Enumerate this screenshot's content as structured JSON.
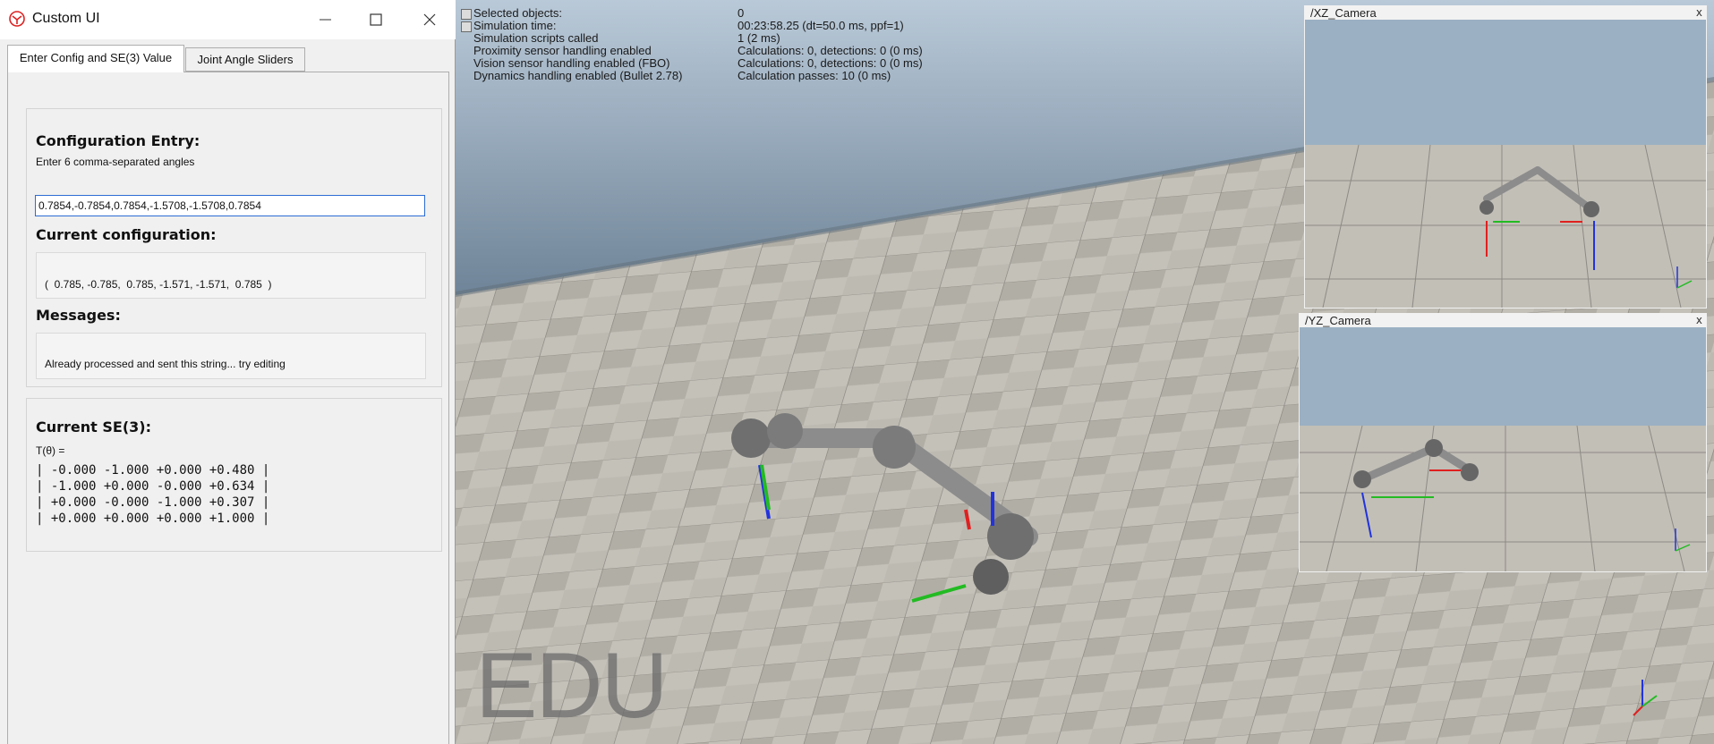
{
  "window": {
    "title": "Custom UI"
  },
  "tabs": [
    {
      "label": "Enter Config and SE(3) Value"
    },
    {
      "label": "Joint Angle Sliders"
    }
  ],
  "config": {
    "heading": "Configuration Entry:",
    "hint": "Enter 6 comma-separated angles",
    "input_value": "0.7854,-0.7854,0.7854,-1.5708,-1.5708,0.7854",
    "current_heading": "Current configuration:",
    "current_value": "(  0.785, -0.785,  0.785, -1.571, -1.571,  0.785  )",
    "messages_heading": "Messages:",
    "message": "Already processed and sent this string... try editing"
  },
  "se3": {
    "heading": "Current SE(3):",
    "label": "T(θ) =",
    "rows": [
      "| -0.000 -1.000 +0.000 +0.480 |",
      "| -1.000 +0.000 -0.000 +0.634 |",
      "| +0.000 -0.000 -1.000 +0.307 |",
      "| +0.000 +0.000 +0.000 +1.000 |"
    ]
  },
  "hud": [
    {
      "key": "Selected objects:",
      "value": "0"
    },
    {
      "key": "Simulation time:",
      "value": "00:23:58.25 (dt=50.0 ms, ppf=1)"
    },
    {
      "key": "Simulation scripts called",
      "value": "1 (2 ms)"
    },
    {
      "key": "Proximity sensor handling enabled",
      "value": "Calculations: 0, detections: 0 (0 ms)"
    },
    {
      "key": "Vision sensor handling enabled (FBO)",
      "value": "Calculations: 0, detections: 0 (0 ms)"
    },
    {
      "key": "Dynamics handling enabled (Bullet 2.78)",
      "value": "Calculation passes: 10 (0 ms)"
    }
  ],
  "watermark": "EDU",
  "cameras": [
    {
      "title": "/XZ_Camera",
      "close": "x"
    },
    {
      "title": "/YZ_Camera",
      "close": "x"
    }
  ],
  "axes_labels": {
    "z": "z",
    "x": "x",
    "y": "y"
  },
  "colors": {
    "x_axis": "#e02020",
    "y_axis": "#22bb22",
    "z_axis": "#2233dd",
    "sky": "#8fa6bb",
    "floor": "#b9b6ae"
  }
}
